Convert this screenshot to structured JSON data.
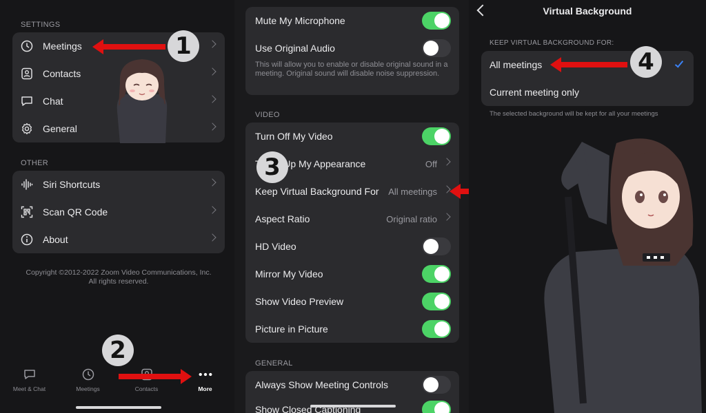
{
  "settings_panel": {
    "section_settings": "SETTINGS",
    "items": [
      {
        "label": "Meetings",
        "icon": "clock-icon"
      },
      {
        "label": "Contacts",
        "icon": "contact-card-icon"
      },
      {
        "label": "Chat",
        "icon": "chat-bubble-icon"
      },
      {
        "label": "General",
        "icon": "gear-icon"
      }
    ],
    "section_other": "OTHER",
    "other_items": [
      {
        "label": "Siri Shortcuts",
        "icon": "waveform-icon"
      },
      {
        "label": "Scan QR Code",
        "icon": "qr-code-icon"
      },
      {
        "label": "About",
        "icon": "info-icon"
      }
    ],
    "copyright": "Copyright ©2012-2022 Zoom Video Communications, Inc.",
    "rights": "All rights reserved."
  },
  "tabbar": {
    "tabs": [
      {
        "label": "Meet & Chat",
        "icon": "chat-bubble-icon"
      },
      {
        "label": "Meetings",
        "icon": "clock-icon"
      },
      {
        "label": "Contacts",
        "icon": "contact-card-icon"
      },
      {
        "label": "More",
        "icon": "more-dots-icon",
        "active": true
      }
    ]
  },
  "meetings_panel": {
    "audio_rows": [
      {
        "label": "Mute My Microphone",
        "toggle": true
      },
      {
        "label": "Use Original Audio",
        "toggle": false
      }
    ],
    "audio_desc": "This will allow you to enable or disable original sound in a meeting. Original sound will disable noise suppression.",
    "section_video": "VIDEO",
    "video_rows": [
      {
        "label": "Turn Off My Video",
        "toggle": true
      },
      {
        "label": "Touch Up My Appearance",
        "value": "Off"
      },
      {
        "label": "Keep Virtual Background For",
        "value": "All meetings"
      },
      {
        "label": "Aspect Ratio",
        "value": "Original ratio"
      },
      {
        "label": "HD Video",
        "toggle": false
      },
      {
        "label": "Mirror My Video",
        "toggle": true
      },
      {
        "label": "Show Video Preview",
        "toggle": true
      },
      {
        "label": "Picture in Picture",
        "toggle": true
      }
    ],
    "section_general": "GENERAL",
    "general_rows": [
      {
        "label": "Always Show Meeting Controls",
        "toggle": false
      },
      {
        "label": "Show Closed Captioning",
        "toggle": true
      }
    ]
  },
  "vb_panel": {
    "title": "Virtual Background",
    "section": "KEEP VIRTUAL BACKGROUND FOR:",
    "options": [
      {
        "label": "All meetings",
        "selected": true
      },
      {
        "label": "Current meeting only",
        "selected": false
      }
    ],
    "hint": "The selected background will be kept for all your meetings"
  },
  "annotations": {
    "step1": "1",
    "step2": "2",
    "step3": "3",
    "step4": "4",
    "arrow_color": "#e01010"
  },
  "colors": {
    "toggle_on": "#4cd366",
    "check": "#3b82f6"
  }
}
